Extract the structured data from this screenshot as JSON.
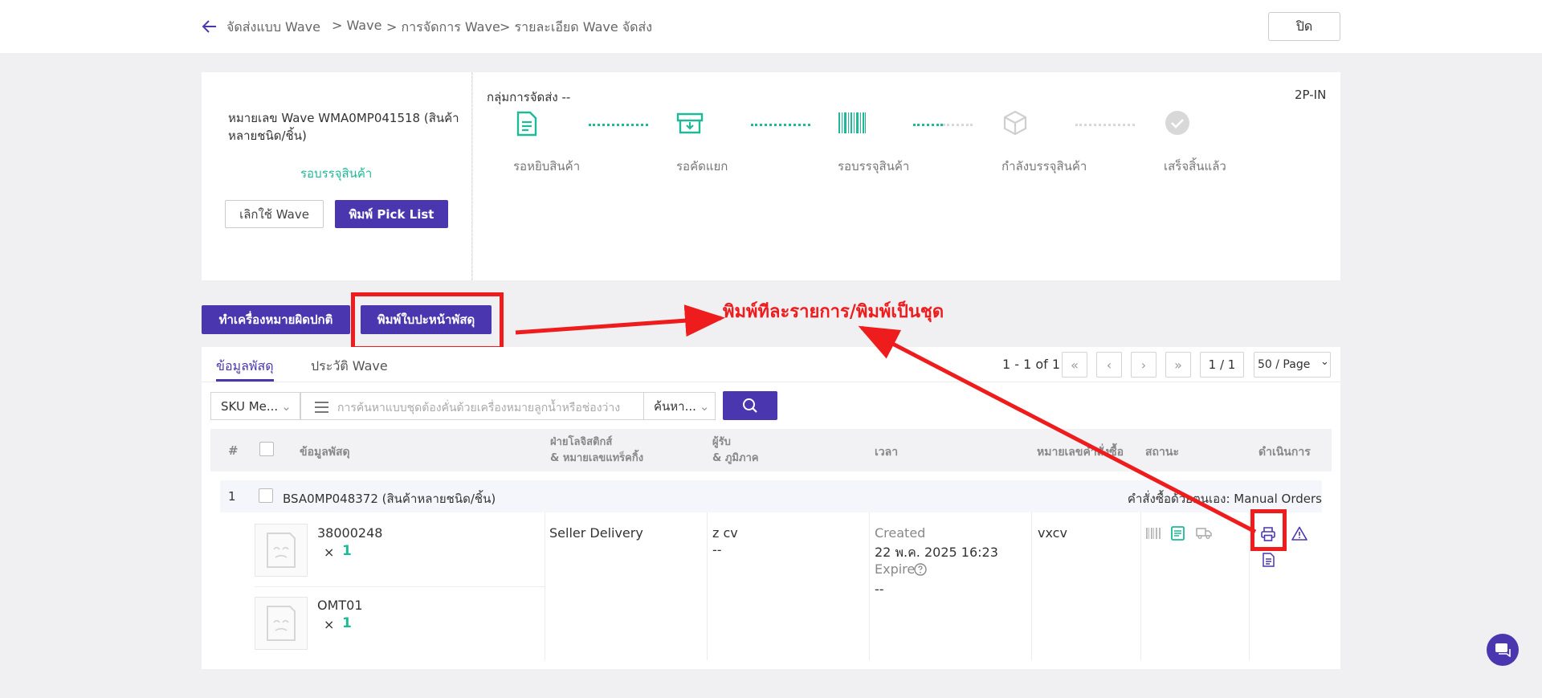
{
  "breadcrumb": {
    "items": [
      "จัดส่งแบบ Wave",
      "> Wave",
      "> การจัดการ Wave",
      "> รายละเอียด Wave จัดส่ง"
    ]
  },
  "header": {
    "close_label": "ปิด"
  },
  "wave": {
    "number_line1": "หมายเลข Wave WMA0MP041518 (สินค้า",
    "number_line2": "หลายชนิด/ชิ้น)",
    "status": "รอบรรจุสินค้า",
    "cancel_label": "เลิกใช้ Wave",
    "print_picklist_label": "พิมพ์ Pick List",
    "group_label": "กลุ่มการจัดส่ง --",
    "warehouse_code": "2P-IN",
    "steps": [
      {
        "label": "รอหยิบสินค้า",
        "icon": "document-icon"
      },
      {
        "label": "รอคัดแยก",
        "icon": "tray-icon"
      },
      {
        "label": "รอบรรจุสินค้า",
        "icon": "barcode-icon"
      },
      {
        "label": "กำลังบรรจุสินค้า",
        "icon": "box-icon"
      },
      {
        "label": "เสร็จสิ้นแล้ว",
        "icon": "check-circle-icon"
      }
    ]
  },
  "actions": {
    "mark_abnormal_label": "ทำเครื่องหมายผิดปกติ",
    "print_label_label": "พิมพ์ใบปะหน้าพัสดุ"
  },
  "annotation": {
    "text": "พิมพ์ทีละรายการ/พิมพ์เป็นชุด"
  },
  "tabs": [
    {
      "label": "ข้อมูลพัสดุ",
      "active": true
    },
    {
      "label": "ประวัติ Wave",
      "active": false
    }
  ],
  "pagination": {
    "range": "1 - 1 of 1",
    "page": "1 / 1",
    "page_size": "50 / Page"
  },
  "search": {
    "field_select": "SKU Me...",
    "placeholder": "การค้นหาแบบชุดต้องคั่นด้วยเครื่องหมายลูกน้ำหรือช่องว่าง",
    "mode_select": "ค้นหา..."
  },
  "table": {
    "headers": {
      "num": "#",
      "parcel": "ข้อมูลพัสดุ",
      "logistics_line1": "ฝ่ายโลจิสติกส์",
      "logistics_line2": "& หมายเลขแทร็คกิ้ง",
      "recipient_line1": "ผู้รับ",
      "recipient_line2": "& ภูมิภาค",
      "time": "เวลา",
      "order_no": "หมายเลขคำสั่งซื้อ",
      "status": "สถานะ",
      "action": "ดำเนินการ"
    },
    "rows": [
      {
        "index": "1",
        "parcel_id": "BSA0MP048372 (สินค้าหลายชนิด/ชิ้น)",
        "order_source": "คำสั่งซื้อด้วยตนเอง: Manual Orders",
        "items": [
          {
            "sku": "38000248",
            "times": "×",
            "qty": "1",
            "image_label": "No Image"
          },
          {
            "sku": "OMT01",
            "times": "×",
            "qty": "1",
            "image_label": "No Image"
          }
        ],
        "logistics": "Seller Delivery",
        "recipient_name": "z cv",
        "region": "--",
        "created_label": "Created",
        "created_time": "22 พ.ค. 2025 16:23",
        "expire_label": "Expire",
        "expire_value": "--",
        "order_no": "vxcv"
      }
    ]
  },
  "colors": {
    "primary": "#4a37b0",
    "success": "#1fb99a",
    "annotation_red": "#ee1c1c"
  }
}
